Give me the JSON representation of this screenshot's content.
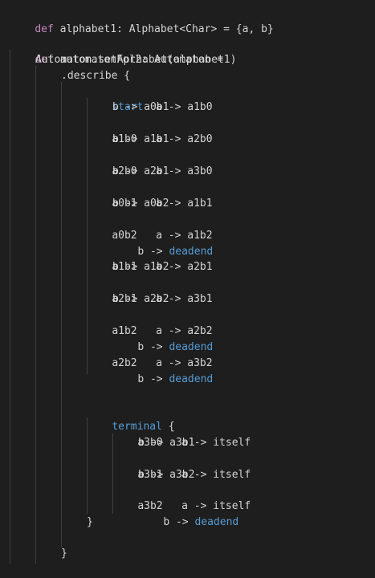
{
  "colors": {
    "background": "#1e1e1e",
    "keyword": "#c586c0",
    "text": "#d4d4d4",
    "terminal": "#569cd6",
    "indent_guide": "#404040"
  },
  "code": {
    "line1": {
      "kw": "def",
      "rest": " alphabet1: Alphabet<Char> = {a, b}"
    },
    "line2": {
      "kw": "def",
      "rest": " automatonFor2: Automaton ="
    },
    "line3": "Automaton.setAplhabet(alphabet1)",
    "line4": ".describe {",
    "start": {
      "state": "start",
      "a": "  a -> a1b0",
      "b": "b -> a0b1"
    },
    "a1b0": {
      "state": "a1b0",
      "a": "   a -> a2b0",
      "b": "b -> a1b1"
    },
    "a2b0": {
      "state": "a2b0",
      "a": "   a -> a3b0",
      "b": "b -> a2b1"
    },
    "a0b1": {
      "state": "a0b1",
      "a": "   a -> a1b1",
      "b": "b -> a0b2"
    },
    "a0b2": {
      "state": "a0b2",
      "a": "   a -> a1b2",
      "b_prefix": "b -> ",
      "b_target": "deadend"
    },
    "a1b1": {
      "state": "a1b1",
      "a": "   a -> a2b1",
      "b": "b -> a1b2"
    },
    "a2b1": {
      "state": "a2b1",
      "a": "   a -> a3b1",
      "b": "b -> a2b2"
    },
    "a1b2": {
      "state": "a1b2",
      "a": "   a -> a2b2",
      "b_prefix": "b -> ",
      "b_target": "deadend"
    },
    "a2b2": {
      "state": "a2b2",
      "a": "   a -> a3b2",
      "b_prefix": "b -> ",
      "b_target": "deadend"
    },
    "terminal_open": {
      "kw": "terminal",
      "rest": " {"
    },
    "a3b0": {
      "state": "a3b0",
      "a": "   a -> itself",
      "b": "b -> a3b1"
    },
    "a3b1": {
      "state": "a3b1",
      "a": "   a -> itself",
      "b": "b -> a3b2"
    },
    "a3b2": {
      "state": "a3b2",
      "a": "   a -> itself",
      "b_prefix": "b -> ",
      "b_target": "deadend"
    },
    "terminal_close": "}",
    "describe_close": "}"
  }
}
